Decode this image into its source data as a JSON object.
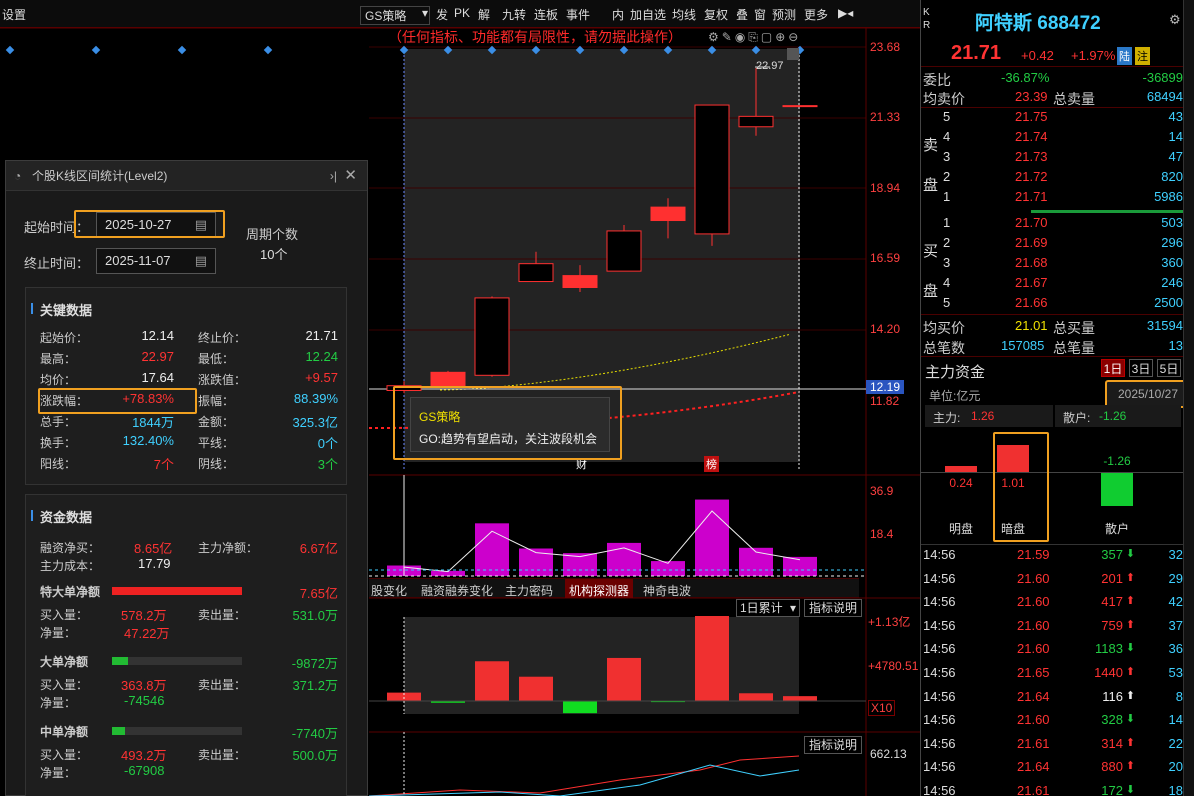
{
  "toolbar": {
    "top_items": [
      "设置",
      "GS策略",
      "发",
      "PK",
      "解",
      "九转",
      "连板",
      "事件",
      "内",
      "加自选",
      "均线",
      "复权",
      "叠",
      "窗",
      "预测",
      "更多"
    ],
    "warning": "（任何指标、功能都有局限性，请勿据此操作）"
  },
  "chart": {
    "price_labels": [
      "23.68",
      "21.33",
      "18.94",
      "16.59",
      "14.20",
      "11.82"
    ],
    "current_price_tag": "12.19",
    "high_marker": "22.97",
    "volume_labels": [
      "36.9",
      "18.4"
    ],
    "tooltip_title": "GS策略",
    "tooltip_text": "GO:趋势有望启动，关注波段机会",
    "bottom_markers": [
      "财",
      "榜"
    ],
    "candles": [
      {
        "open": 12.3,
        "close": 12.14,
        "high": 12.45,
        "low": 12.05,
        "color": "up"
      },
      {
        "open": 12.24,
        "close": 12.75,
        "high": 12.8,
        "low": 12.24,
        "color": "up"
      },
      {
        "open": 12.65,
        "close": 15.25,
        "high": 15.3,
        "low": 12.6,
        "color": "up"
      },
      {
        "open": 15.8,
        "close": 16.4,
        "high": 16.8,
        "low": 15.8,
        "color": "up"
      },
      {
        "open": 16.0,
        "close": 15.6,
        "high": 16.35,
        "low": 15.45,
        "color": "down"
      },
      {
        "open": 16.15,
        "close": 17.5,
        "high": 17.7,
        "low": 16.15,
        "color": "up"
      },
      {
        "open": 18.3,
        "close": 17.85,
        "high": 18.6,
        "low": 17.25,
        "color": "down"
      },
      {
        "open": 17.4,
        "close": 21.73,
        "high": 21.73,
        "low": 17.0,
        "color": "up"
      },
      {
        "open": 21.0,
        "close": 21.35,
        "high": 22.97,
        "low": 20.7,
        "color": "up"
      },
      {
        "open": 21.71,
        "close": 21.71,
        "high": 21.71,
        "low": 21.71,
        "color": "up"
      }
    ],
    "volumes": [
      4.5,
      2.2,
      22.6,
      11.8,
      9.8,
      14.2,
      6.4,
      32.8,
      12.1,
      8.2
    ],
    "tabs": [
      "股变化",
      "融资融券变化",
      "主力密码",
      "机构探测器",
      "神奇电波"
    ],
    "cum_label": "1日累计",
    "indicator_btn": "指标说明",
    "flow_labels": [
      "+1.13亿",
      "+4780.51",
      "X10"
    ],
    "flow_values": [
      0.38,
      -0.08,
      1.8,
      1.1,
      -0.55,
      1.95,
      -0.05,
      3.85,
      0.35,
      0.22
    ],
    "bottom_indicator_label": "662.13",
    "bottom_indicator_btn": "指标说明"
  },
  "stats": {
    "title": "个股K线区间统计(Level2)",
    "start_label": "起始时间",
    "start_date": "2025-10-27",
    "end_label": "终止时间",
    "end_date": "2025-11-07",
    "period_label": "周期个数",
    "period_value": "10个",
    "key_title": "关键数据",
    "key": [
      {
        "k": "起始价",
        "v": "12.14",
        "c": "white"
      },
      {
        "k": "终止价",
        "v": "21.71",
        "c": "white"
      },
      {
        "k": "最高",
        "v": "22.97",
        "c": "red"
      },
      {
        "k": "最低",
        "v": "12.24",
        "c": "green"
      },
      {
        "k": "均价",
        "v": "17.64",
        "c": "white"
      },
      {
        "k": "涨跌值",
        "v": "+9.57",
        "c": "red"
      },
      {
        "k": "涨跌幅",
        "v": "+78.83%",
        "c": "red"
      },
      {
        "k": "振幅",
        "v": "88.39%",
        "c": "cyan"
      },
      {
        "k": "总手",
        "v": "1844万",
        "c": "cyan"
      },
      {
        "k": "金额",
        "v": "325.3亿",
        "c": "cyan"
      },
      {
        "k": "换手",
        "v": "132.40%",
        "c": "cyan"
      },
      {
        "k": "平线",
        "v": "0个",
        "c": "cyan"
      },
      {
        "k": "阳线",
        "v": "7个",
        "c": "red"
      },
      {
        "k": "阴线",
        "v": "3个",
        "c": "green"
      }
    ],
    "fund_title": "资金数据",
    "margin_label": "融资净买",
    "margin_value": "8.65亿",
    "main_net_label": "主力净额",
    "main_net_value": "6.67亿",
    "main_cost_label": "主力成本",
    "main_cost_value": "17.79",
    "groups": [
      {
        "name": "特大单净额",
        "value": "7.65亿",
        "c": "red",
        "bar": 1.0,
        "buy_label": "买入量",
        "buy": "578.2万",
        "sell_label": "卖出量",
        "sell": "531.0万",
        "net_label": "净量",
        "net": "47.22万",
        "net_c": "red"
      },
      {
        "name": "大单净额",
        "value": "-9872万",
        "c": "green",
        "bar": 0.12,
        "buy_label": "买入量",
        "buy": "363.8万",
        "sell_label": "卖出量",
        "sell": "371.2万",
        "net_label": "净量",
        "net": "-74546",
        "net_c": "green"
      },
      {
        "name": "中单净额",
        "value": "-7740万",
        "c": "green",
        "bar": 0.1,
        "buy_label": "买入量",
        "buy": "493.2万",
        "sell_label": "卖出量",
        "sell": "500.0万",
        "net_label": "净量",
        "net": "-67908",
        "net_c": "green"
      }
    ]
  },
  "quote": {
    "name": "阿特斯",
    "code": "688472",
    "kr": "K R",
    "price": "21.71",
    "change": "+0.42",
    "change_pct": "+1.97%",
    "badge1": "陆",
    "badge2": "注",
    "wb_label": "委比",
    "wb_value": "-36.87%",
    "wb_diff": "-36899",
    "avg_sell_label": "均卖价",
    "avg_sell": "23.39",
    "total_sell_label": "总卖量",
    "total_sell": "68494",
    "sell_side": "卖盘",
    "buy_side": "买盘",
    "asks": [
      {
        "lvl": "5",
        "price": "21.75",
        "vol": "43"
      },
      {
        "lvl": "4",
        "price": "21.74",
        "vol": "14"
      },
      {
        "lvl": "3",
        "price": "21.73",
        "vol": "47"
      },
      {
        "lvl": "2",
        "price": "21.72",
        "vol": "820"
      },
      {
        "lvl": "1",
        "price": "21.71",
        "vol": "5986"
      }
    ],
    "bids": [
      {
        "lvl": "1",
        "price": "21.70",
        "vol": "503"
      },
      {
        "lvl": "2",
        "price": "21.69",
        "vol": "296"
      },
      {
        "lvl": "3",
        "price": "21.68",
        "vol": "360"
      },
      {
        "lvl": "4",
        "price": "21.67",
        "vol": "246"
      },
      {
        "lvl": "5",
        "price": "21.66",
        "vol": "2500"
      }
    ],
    "avg_buy_label": "均买价",
    "avg_buy": "21.01",
    "total_buy_label": "总买量",
    "total_buy": "31594",
    "total_trades_label": "总笔数",
    "total_trades": "157085",
    "per_trade_label": "总笔量",
    "per_trade": "13",
    "capital_title": "主力资金",
    "unit": "单位:亿元",
    "tabs": [
      "1日",
      "3日",
      "5日"
    ],
    "date": "2025/10/27",
    "main_label": "主力:",
    "main_value": "1.26",
    "retail_label": "散户:",
    "retail_value": "-1.26",
    "bars": [
      {
        "label": "明盘",
        "value": "0.24",
        "num": 0.24
      },
      {
        "label": "暗盘",
        "value": "1.01",
        "num": 1.01
      },
      {
        "label": "散户",
        "value": "-1.26",
        "num": -1.26
      }
    ],
    "ticks": [
      {
        "t": "14:56",
        "p": "21.59",
        "v": "357",
        "dir": "down",
        "n": "32"
      },
      {
        "t": "14:56",
        "p": "21.60",
        "v": "201",
        "dir": "up",
        "n": "29"
      },
      {
        "t": "14:56",
        "p": "21.60",
        "v": "417",
        "dir": "up",
        "n": "42"
      },
      {
        "t": "14:56",
        "p": "21.60",
        "v": "759",
        "dir": "up",
        "n": "37"
      },
      {
        "t": "14:56",
        "p": "21.60",
        "v": "1183",
        "dir": "down",
        "n": "36"
      },
      {
        "t": "14:56",
        "p": "21.65",
        "v": "1440",
        "dir": "up",
        "n": "53"
      },
      {
        "t": "14:56",
        "p": "21.64",
        "v": "116",
        "dir": "white",
        "n": "8"
      },
      {
        "t": "14:56",
        "p": "21.60",
        "v": "328",
        "dir": "down",
        "n": "14"
      },
      {
        "t": "14:56",
        "p": "21.61",
        "v": "314",
        "dir": "up",
        "n": "22"
      },
      {
        "t": "14:56",
        "p": "21.64",
        "v": "880",
        "dir": "up",
        "n": "20"
      },
      {
        "t": "14:56",
        "p": "21.61",
        "v": "172",
        "dir": "down",
        "n": "18"
      }
    ]
  }
}
